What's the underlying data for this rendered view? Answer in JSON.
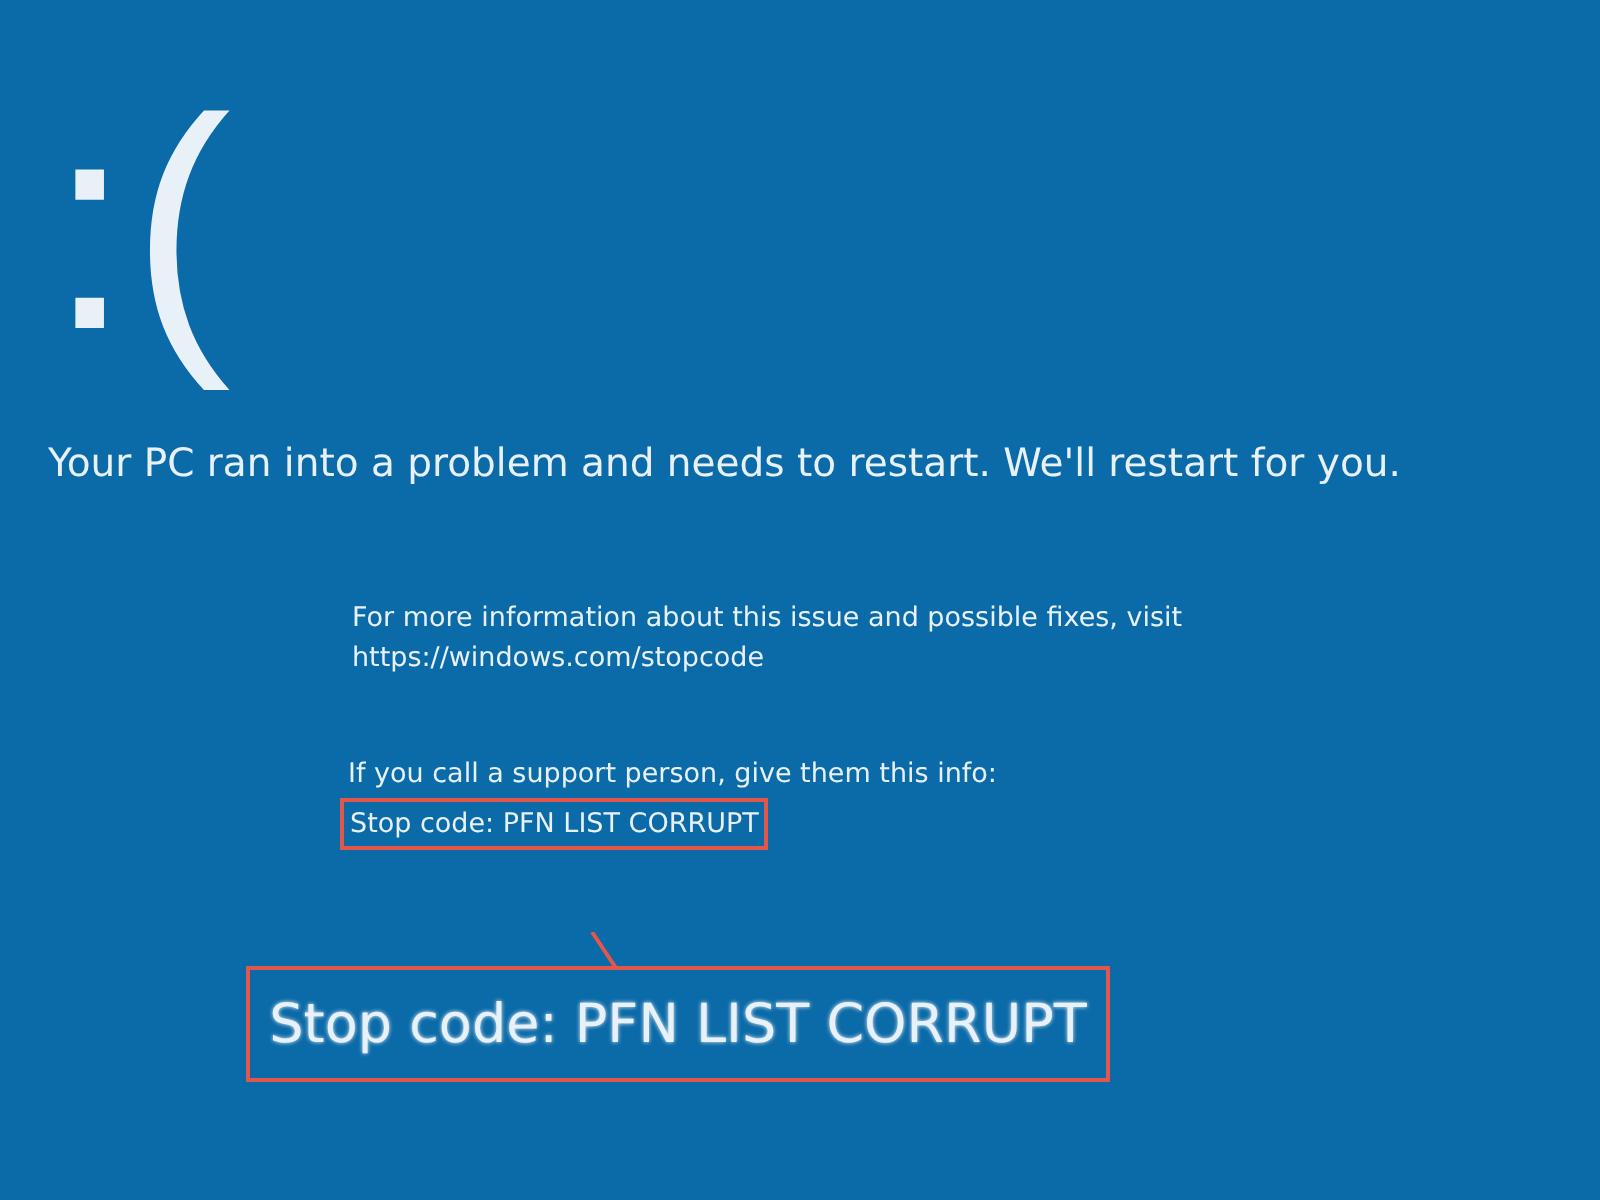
{
  "face": ":(",
  "message": "Your PC ran into a problem and needs to restart. We'll restart for you.",
  "info": [
    "For more information about this issue and possible fixes, visit",
    "https://windows.com/stopcode"
  ],
  "support": "If you call a support person, give them this info:",
  "stop_code": {
    "text": "Stop code: PFN LIST CORRUPT",
    "highlighted": true
  },
  "callout": {
    "text": "Stop code: PFN LIST CORRUPT"
  }
}
